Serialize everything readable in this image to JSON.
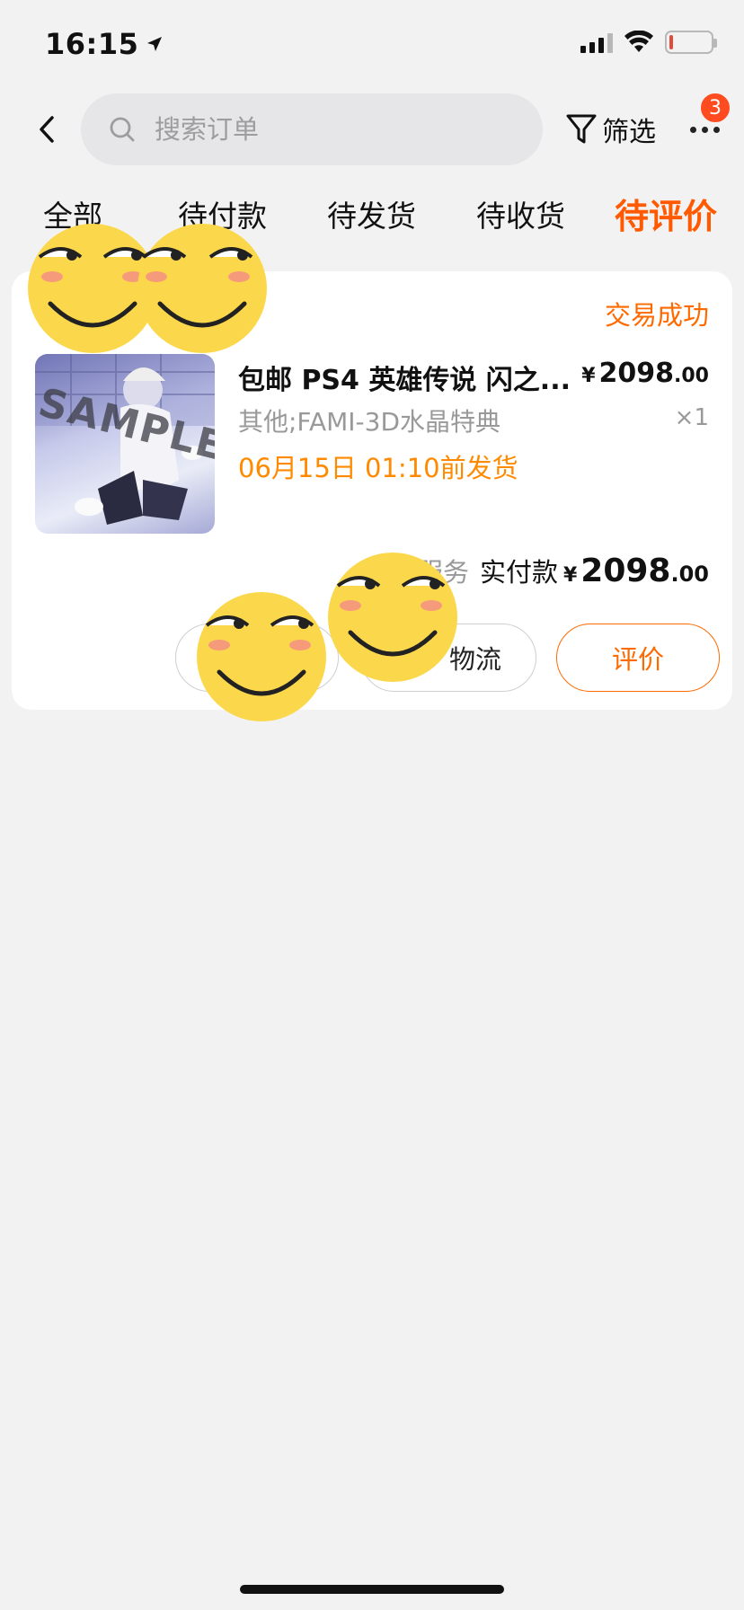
{
  "status_bar": {
    "time": "16:15"
  },
  "header": {
    "search_placeholder": "搜索订单",
    "filter_label": "筛选",
    "more_badge": "3"
  },
  "tabs": [
    {
      "label": "全部",
      "active": false
    },
    {
      "label": "待付款",
      "active": false
    },
    {
      "label": "待发货",
      "active": false
    },
    {
      "label": "待收货",
      "active": false
    },
    {
      "label": "待评价",
      "active": true
    }
  ],
  "order": {
    "status": "交易成功",
    "thumbnail_watermark": "SAMPLE",
    "product": {
      "title": "包邮 PS4 英雄传说 闪之...",
      "price_int": "2098",
      "price_dec": ".00",
      "currency": "¥",
      "spec": "其他;FAMI-3D水晶特典",
      "qty": "×1",
      "ship_time": "06月15日 01:10前发货"
    },
    "total": {
      "service_text": "含服务",
      "label": "实付款",
      "currency": "¥",
      "amount_int": "2098",
      "amount_dec": ".00"
    },
    "buttons": {
      "more": "",
      "logistics": "物流",
      "review": "评价"
    }
  },
  "colors": {
    "accent": "#ff5a00",
    "ship_time": "#ff8a00",
    "badge": "#ff4b1f"
  }
}
